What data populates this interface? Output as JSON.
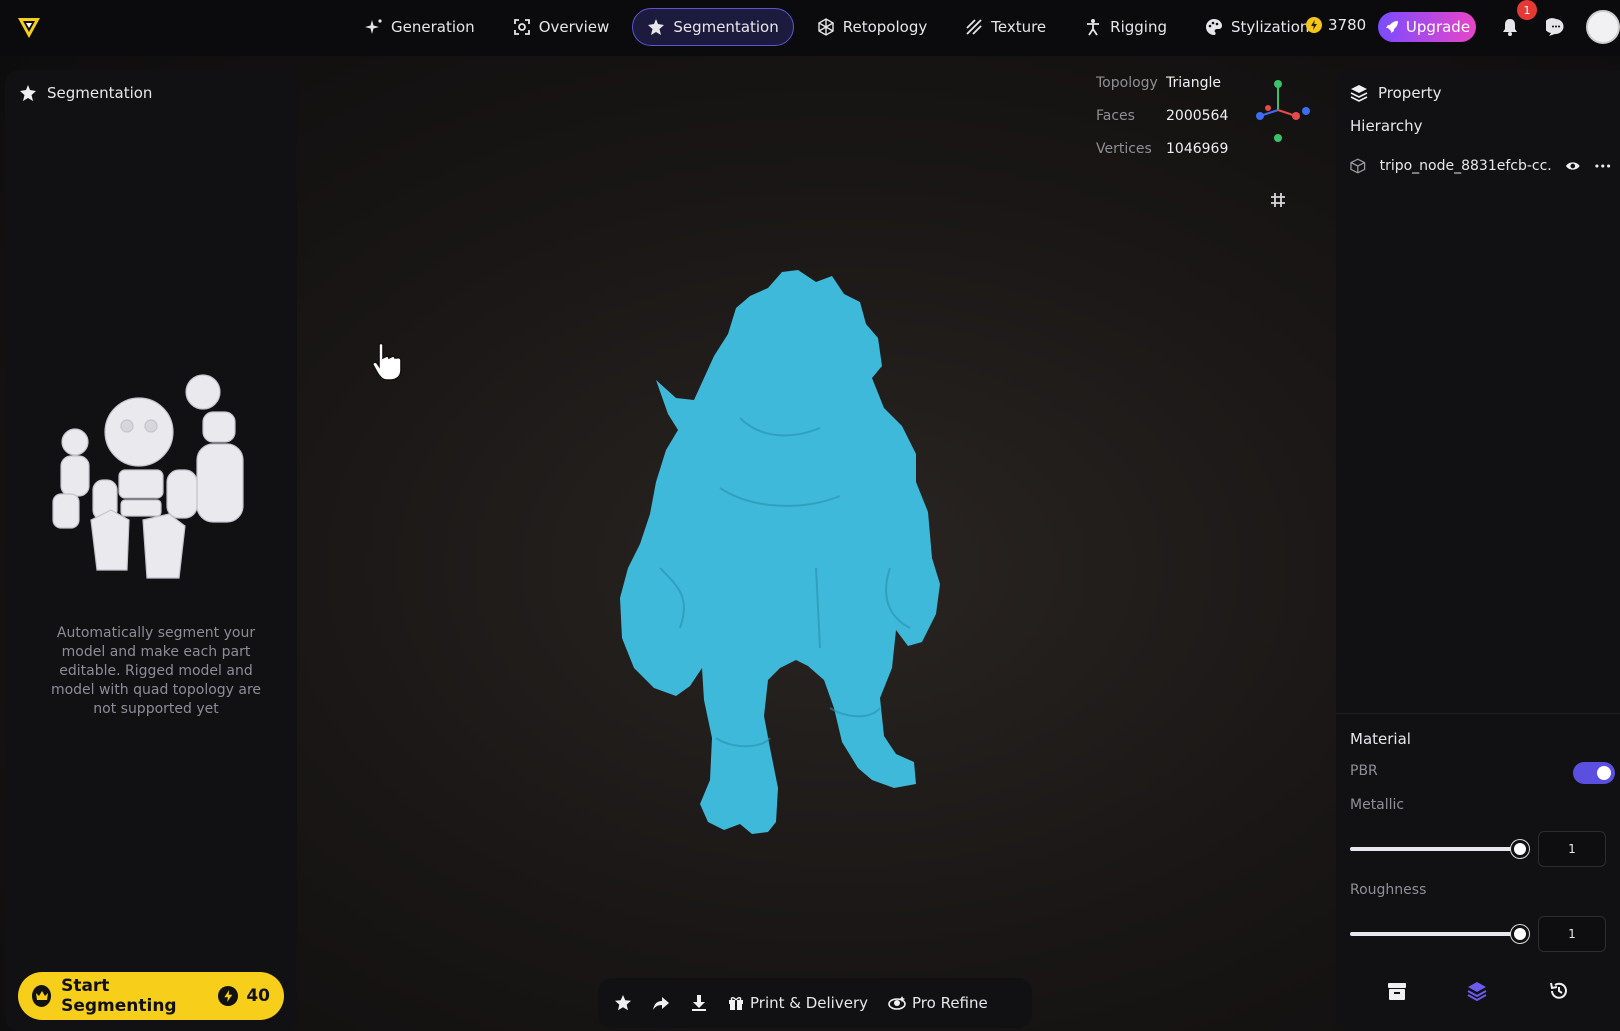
{
  "nav": {
    "items": [
      {
        "label": "Generation",
        "icon": "sparkle-icon"
      },
      {
        "label": "Overview",
        "icon": "scan-icon"
      },
      {
        "label": "Segmentation",
        "icon": "segment-icon",
        "active": true
      },
      {
        "label": "Retopology",
        "icon": "mesh-icon"
      },
      {
        "label": "Texture",
        "icon": "texture-icon"
      },
      {
        "label": "Rigging",
        "icon": "rig-figure-icon"
      },
      {
        "label": "Stylization",
        "icon": "palette-icon"
      }
    ],
    "credits": "3780",
    "upgrade_label": "Upgrade",
    "notification_count": "1"
  },
  "left_panel": {
    "title": "Segmentation",
    "description": "Automatically segment your model and make each part editable. Rigged model and model with quad topology are not supported yet",
    "start_label": "Start Segmenting",
    "start_cost": "40"
  },
  "viewport": {
    "stats": [
      {
        "label": "Topology",
        "value": "Triangle"
      },
      {
        "label": "Faces",
        "value": "2000564"
      },
      {
        "label": "Vertices",
        "value": "1046969"
      }
    ],
    "model_color": "#3fb9d9"
  },
  "bottom_bar": {
    "print_label": "Print & Delivery",
    "refine_label": "Pro Refine"
  },
  "right_panel": {
    "title": "Property",
    "hierarchy_label": "Hierarchy",
    "node_name": "tripo_node_8831efcb-cc...",
    "material": {
      "title": "Material",
      "pbr_label": "PBR",
      "pbr_enabled": true,
      "metallic_label": "Metallic",
      "metallic_value": "1",
      "roughness_label": "Roughness",
      "roughness_value": "1"
    }
  },
  "colors": {
    "accent": "#5b4fe0",
    "start_button": "#f7cf1a",
    "upgrade_gradient": [
      "#7a4cff",
      "#e845c8"
    ]
  }
}
